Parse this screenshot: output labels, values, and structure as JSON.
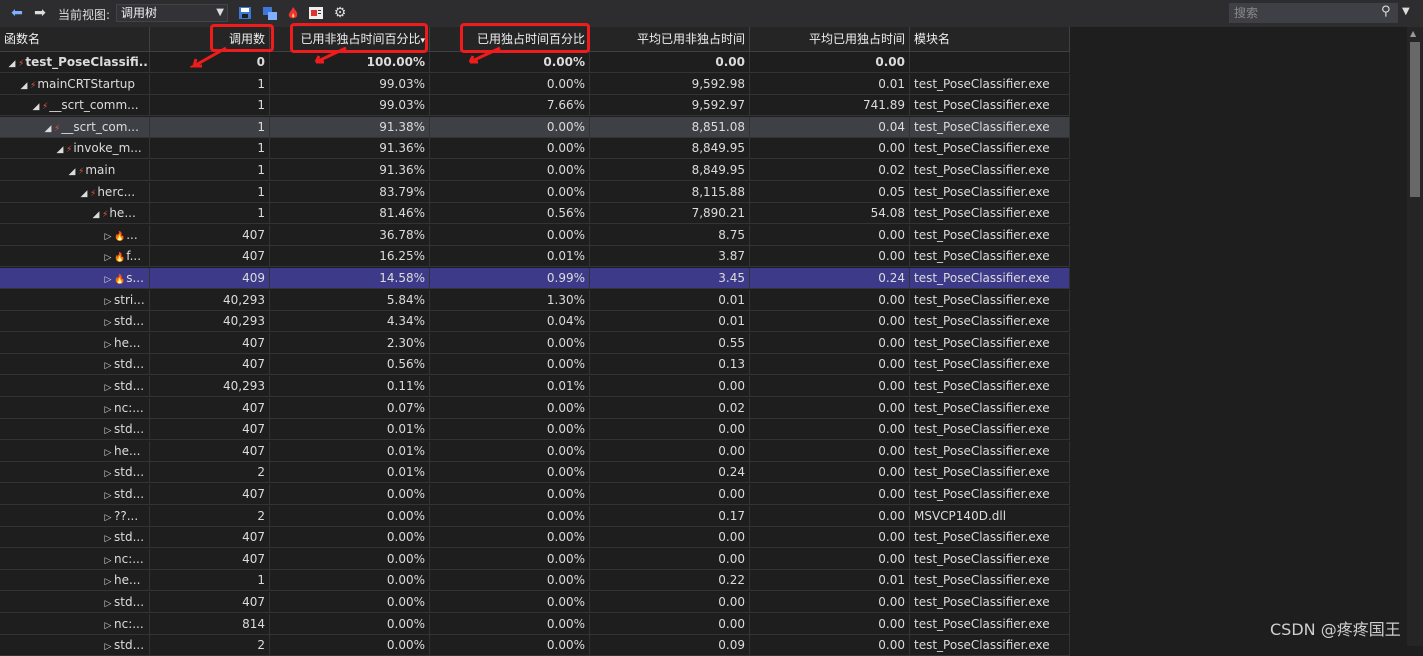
{
  "toolbar": {
    "view_label": "当前视图:",
    "view_value": "调用树",
    "search_placeholder": "搜索"
  },
  "columns": [
    "函数名",
    "调用数",
    "已用非独占时间百分比",
    "已用独占时间百分比",
    "平均已用非独占时间",
    "平均已用独占时间",
    "模块名"
  ],
  "sort_indicator": "▾",
  "rows": [
    {
      "name": "test_PoseClassifi...",
      "calls": "0",
      "incl_pct": "100.00%",
      "excl_pct": "0.00%",
      "avg_incl": "0.00",
      "avg_excl": "0.00",
      "module": "",
      "depth": 0,
      "toggle": "◢",
      "icon": "hot-path",
      "bold": true,
      "sel": ""
    },
    {
      "name": "mainCRTStartup",
      "calls": "1",
      "incl_pct": "99.03%",
      "excl_pct": "0.00%",
      "avg_incl": "9,592.98",
      "avg_excl": "0.01",
      "module": "test_PoseClassifier.exe",
      "depth": 1,
      "toggle": "◢",
      "icon": "hot-path",
      "bold": false,
      "sel": ""
    },
    {
      "name": "__scrt_comm...",
      "calls": "1",
      "incl_pct": "99.03%",
      "excl_pct": "7.66%",
      "avg_incl": "9,592.97",
      "avg_excl": "741.89",
      "module": "test_PoseClassifier.exe",
      "depth": 2,
      "toggle": "◢",
      "icon": "hot-path",
      "bold": false,
      "sel": ""
    },
    {
      "name": "__scrt_com...",
      "calls": "1",
      "incl_pct": "91.38%",
      "excl_pct": "0.00%",
      "avg_incl": "8,851.08",
      "avg_excl": "0.04",
      "module": "test_PoseClassifier.exe",
      "depth": 3,
      "toggle": "◢",
      "icon": "hot-path",
      "bold": false,
      "sel": "gray"
    },
    {
      "name": "invoke_m...",
      "calls": "1",
      "incl_pct": "91.36%",
      "excl_pct": "0.00%",
      "avg_incl": "8,849.95",
      "avg_excl": "0.00",
      "module": "test_PoseClassifier.exe",
      "depth": 4,
      "toggle": "◢",
      "icon": "hot-path",
      "bold": false,
      "sel": ""
    },
    {
      "name": "main",
      "calls": "1",
      "incl_pct": "91.36%",
      "excl_pct": "0.00%",
      "avg_incl": "8,849.95",
      "avg_excl": "0.02",
      "module": "test_PoseClassifier.exe",
      "depth": 5,
      "toggle": "◢",
      "icon": "hot-path",
      "bold": false,
      "sel": ""
    },
    {
      "name": "herc...",
      "calls": "1",
      "incl_pct": "83.79%",
      "excl_pct": "0.00%",
      "avg_incl": "8,115.88",
      "avg_excl": "0.05",
      "module": "test_PoseClassifier.exe",
      "depth": 6,
      "toggle": "◢",
      "icon": "hot-path",
      "bold": false,
      "sel": ""
    },
    {
      "name": "he...",
      "calls": "1",
      "incl_pct": "81.46%",
      "excl_pct": "0.56%",
      "avg_incl": "7,890.21",
      "avg_excl": "54.08",
      "module": "test_PoseClassifier.exe",
      "depth": 7,
      "toggle": "◢",
      "icon": "hot-path",
      "bold": false,
      "sel": ""
    },
    {
      "name": "...",
      "calls": "407",
      "incl_pct": "36.78%",
      "excl_pct": "0.00%",
      "avg_incl": "8.75",
      "avg_excl": "0.00",
      "module": "test_PoseClassifier.exe",
      "depth": 8,
      "toggle": "▷",
      "icon": "flame",
      "bold": false,
      "sel": ""
    },
    {
      "name": "f...",
      "calls": "407",
      "incl_pct": "16.25%",
      "excl_pct": "0.01%",
      "avg_incl": "3.87",
      "avg_excl": "0.00",
      "module": "test_PoseClassifier.exe",
      "depth": 8,
      "toggle": "▷",
      "icon": "flame",
      "bold": false,
      "sel": ""
    },
    {
      "name": "s...",
      "calls": "409",
      "incl_pct": "14.58%",
      "excl_pct": "0.99%",
      "avg_incl": "3.45",
      "avg_excl": "0.24",
      "module": "test_PoseClassifier.exe",
      "depth": 8,
      "toggle": "▷",
      "icon": "flame",
      "bold": false,
      "sel": "blue"
    },
    {
      "name": "stri...",
      "calls": "40,293",
      "incl_pct": "5.84%",
      "excl_pct": "1.30%",
      "avg_incl": "0.01",
      "avg_excl": "0.00",
      "module": "test_PoseClassifier.exe",
      "depth": 8,
      "toggle": "▷",
      "icon": "",
      "bold": false,
      "sel": ""
    },
    {
      "name": "std...",
      "calls": "40,293",
      "incl_pct": "4.34%",
      "excl_pct": "0.04%",
      "avg_incl": "0.01",
      "avg_excl": "0.00",
      "module": "test_PoseClassifier.exe",
      "depth": 8,
      "toggle": "▷",
      "icon": "",
      "bold": false,
      "sel": ""
    },
    {
      "name": "he...",
      "calls": "407",
      "incl_pct": "2.30%",
      "excl_pct": "0.00%",
      "avg_incl": "0.55",
      "avg_excl": "0.00",
      "module": "test_PoseClassifier.exe",
      "depth": 8,
      "toggle": "▷",
      "icon": "",
      "bold": false,
      "sel": ""
    },
    {
      "name": "std...",
      "calls": "407",
      "incl_pct": "0.56%",
      "excl_pct": "0.00%",
      "avg_incl": "0.13",
      "avg_excl": "0.00",
      "module": "test_PoseClassifier.exe",
      "depth": 8,
      "toggle": "▷",
      "icon": "",
      "bold": false,
      "sel": ""
    },
    {
      "name": "std...",
      "calls": "40,293",
      "incl_pct": "0.11%",
      "excl_pct": "0.01%",
      "avg_incl": "0.00",
      "avg_excl": "0.00",
      "module": "test_PoseClassifier.exe",
      "depth": 8,
      "toggle": "▷",
      "icon": "",
      "bold": false,
      "sel": ""
    },
    {
      "name": "nc:...",
      "calls": "407",
      "incl_pct": "0.07%",
      "excl_pct": "0.00%",
      "avg_incl": "0.02",
      "avg_excl": "0.00",
      "module": "test_PoseClassifier.exe",
      "depth": 8,
      "toggle": "▷",
      "icon": "",
      "bold": false,
      "sel": ""
    },
    {
      "name": "std...",
      "calls": "407",
      "incl_pct": "0.01%",
      "excl_pct": "0.00%",
      "avg_incl": "0.00",
      "avg_excl": "0.00",
      "module": "test_PoseClassifier.exe",
      "depth": 8,
      "toggle": "▷",
      "icon": "",
      "bold": false,
      "sel": ""
    },
    {
      "name": "he...",
      "calls": "407",
      "incl_pct": "0.01%",
      "excl_pct": "0.00%",
      "avg_incl": "0.00",
      "avg_excl": "0.00",
      "module": "test_PoseClassifier.exe",
      "depth": 8,
      "toggle": "▷",
      "icon": "",
      "bold": false,
      "sel": ""
    },
    {
      "name": "std...",
      "calls": "2",
      "incl_pct": "0.01%",
      "excl_pct": "0.00%",
      "avg_incl": "0.24",
      "avg_excl": "0.00",
      "module": "test_PoseClassifier.exe",
      "depth": 8,
      "toggle": "▷",
      "icon": "",
      "bold": false,
      "sel": ""
    },
    {
      "name": "std...",
      "calls": "407",
      "incl_pct": "0.00%",
      "excl_pct": "0.00%",
      "avg_incl": "0.00",
      "avg_excl": "0.00",
      "module": "test_PoseClassifier.exe",
      "depth": 8,
      "toggle": "▷",
      "icon": "",
      "bold": false,
      "sel": ""
    },
    {
      "name": "??...",
      "calls": "2",
      "incl_pct": "0.00%",
      "excl_pct": "0.00%",
      "avg_incl": "0.17",
      "avg_excl": "0.00",
      "module": "MSVCP140D.dll",
      "depth": 8,
      "toggle": "▷",
      "icon": "",
      "bold": false,
      "sel": ""
    },
    {
      "name": "std...",
      "calls": "407",
      "incl_pct": "0.00%",
      "excl_pct": "0.00%",
      "avg_incl": "0.00",
      "avg_excl": "0.00",
      "module": "test_PoseClassifier.exe",
      "depth": 8,
      "toggle": "▷",
      "icon": "",
      "bold": false,
      "sel": ""
    },
    {
      "name": "nc:...",
      "calls": "407",
      "incl_pct": "0.00%",
      "excl_pct": "0.00%",
      "avg_incl": "0.00",
      "avg_excl": "0.00",
      "module": "test_PoseClassifier.exe",
      "depth": 8,
      "toggle": "▷",
      "icon": "",
      "bold": false,
      "sel": ""
    },
    {
      "name": "he...",
      "calls": "1",
      "incl_pct": "0.00%",
      "excl_pct": "0.00%",
      "avg_incl": "0.22",
      "avg_excl": "0.01",
      "module": "test_PoseClassifier.exe",
      "depth": 8,
      "toggle": "▷",
      "icon": "",
      "bold": false,
      "sel": ""
    },
    {
      "name": "std...",
      "calls": "407",
      "incl_pct": "0.00%",
      "excl_pct": "0.00%",
      "avg_incl": "0.00",
      "avg_excl": "0.00",
      "module": "test_PoseClassifier.exe",
      "depth": 8,
      "toggle": "▷",
      "icon": "",
      "bold": false,
      "sel": ""
    },
    {
      "name": "nc:...",
      "calls": "814",
      "incl_pct": "0.00%",
      "excl_pct": "0.00%",
      "avg_incl": "0.00",
      "avg_excl": "0.00",
      "module": "test_PoseClassifier.exe",
      "depth": 8,
      "toggle": "▷",
      "icon": "",
      "bold": false,
      "sel": ""
    },
    {
      "name": "std...",
      "calls": "2",
      "incl_pct": "0.00%",
      "excl_pct": "0.00%",
      "avg_incl": "0.09",
      "avg_excl": "0.00",
      "module": "test_PoseClassifier.exe",
      "depth": 8,
      "toggle": "▷",
      "icon": "",
      "bold": false,
      "sel": ""
    }
  ],
  "colors": {
    "highlight_red": "#ee1c1c",
    "selected_row": "#3e3a8a",
    "hot_path": "#e05a3a"
  },
  "watermark": "CSDN @疼疼国王"
}
